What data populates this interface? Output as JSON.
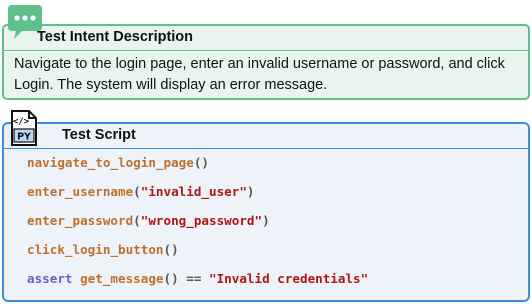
{
  "intent": {
    "title": "Test Intent Description",
    "text": "Navigate to the login page, enter an invalid username or password, and click Login. The system will display an error message."
  },
  "script": {
    "title": "Test Script",
    "icon_label": "PY",
    "icon_tag": "</>",
    "lines": {
      "l1": {
        "fn": "navigate_to_login_page",
        "args": "()"
      },
      "l2": {
        "fn": "enter_username",
        "open": "(",
        "str": "\"invalid_user\"",
        "close": ")"
      },
      "l3": {
        "fn": "enter_password",
        "open": "(",
        "str": "\"wrong_password\"",
        "close": ")"
      },
      "l4": {
        "fn": "click_login_button",
        "args": "()"
      },
      "l5": {
        "kw": "assert",
        "fn": "get_message",
        "args": "() == ",
        "str": "\"Invalid credentials\""
      }
    }
  },
  "colors": {
    "intent_border": "#5fc08a",
    "intent_bg": "#e8f5ee",
    "script_border": "#3a8fe0",
    "script_bg": "#eef3fa",
    "function": "#c0702a",
    "string": "#b01515",
    "keyword": "#6a5fc7"
  },
  "icons": [
    "chat-bubble-icon",
    "python-file-icon"
  ]
}
